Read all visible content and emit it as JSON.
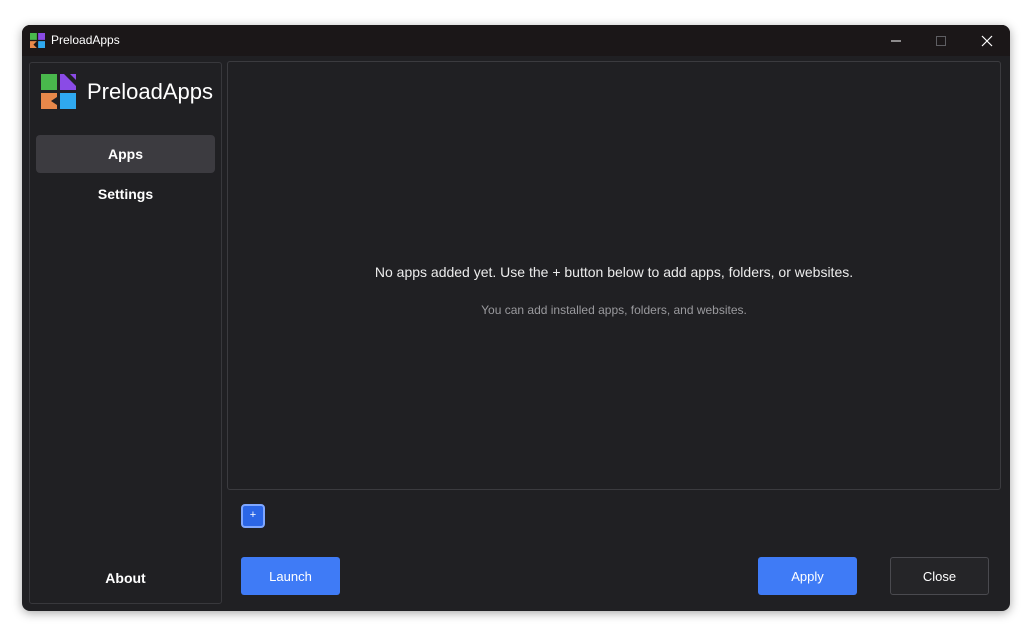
{
  "window": {
    "title": "PreloadApps",
    "controls": {
      "minimize": "minimize-icon",
      "maximize": "maximize-icon",
      "close": "close-icon"
    }
  },
  "sidebar": {
    "brand": "PreloadApps",
    "items": [
      {
        "label": "Apps",
        "active": true
      },
      {
        "label": "Settings",
        "active": false
      }
    ],
    "about_label": "About"
  },
  "main": {
    "empty_message": "No apps added yet. Use the + button below to add apps, folders, or websites.",
    "empty_hint": "You can add installed apps, folders, and websites."
  },
  "footer": {
    "add_label": "+",
    "launch_label": "Launch",
    "apply_label": "Apply",
    "close_label": "Close"
  },
  "colors": {
    "accent": "#3f7bf6",
    "logo_green": "#49b84c",
    "logo_purple": "#8a4be6",
    "logo_orange": "#e8884a",
    "logo_blue": "#2fa9f0"
  }
}
